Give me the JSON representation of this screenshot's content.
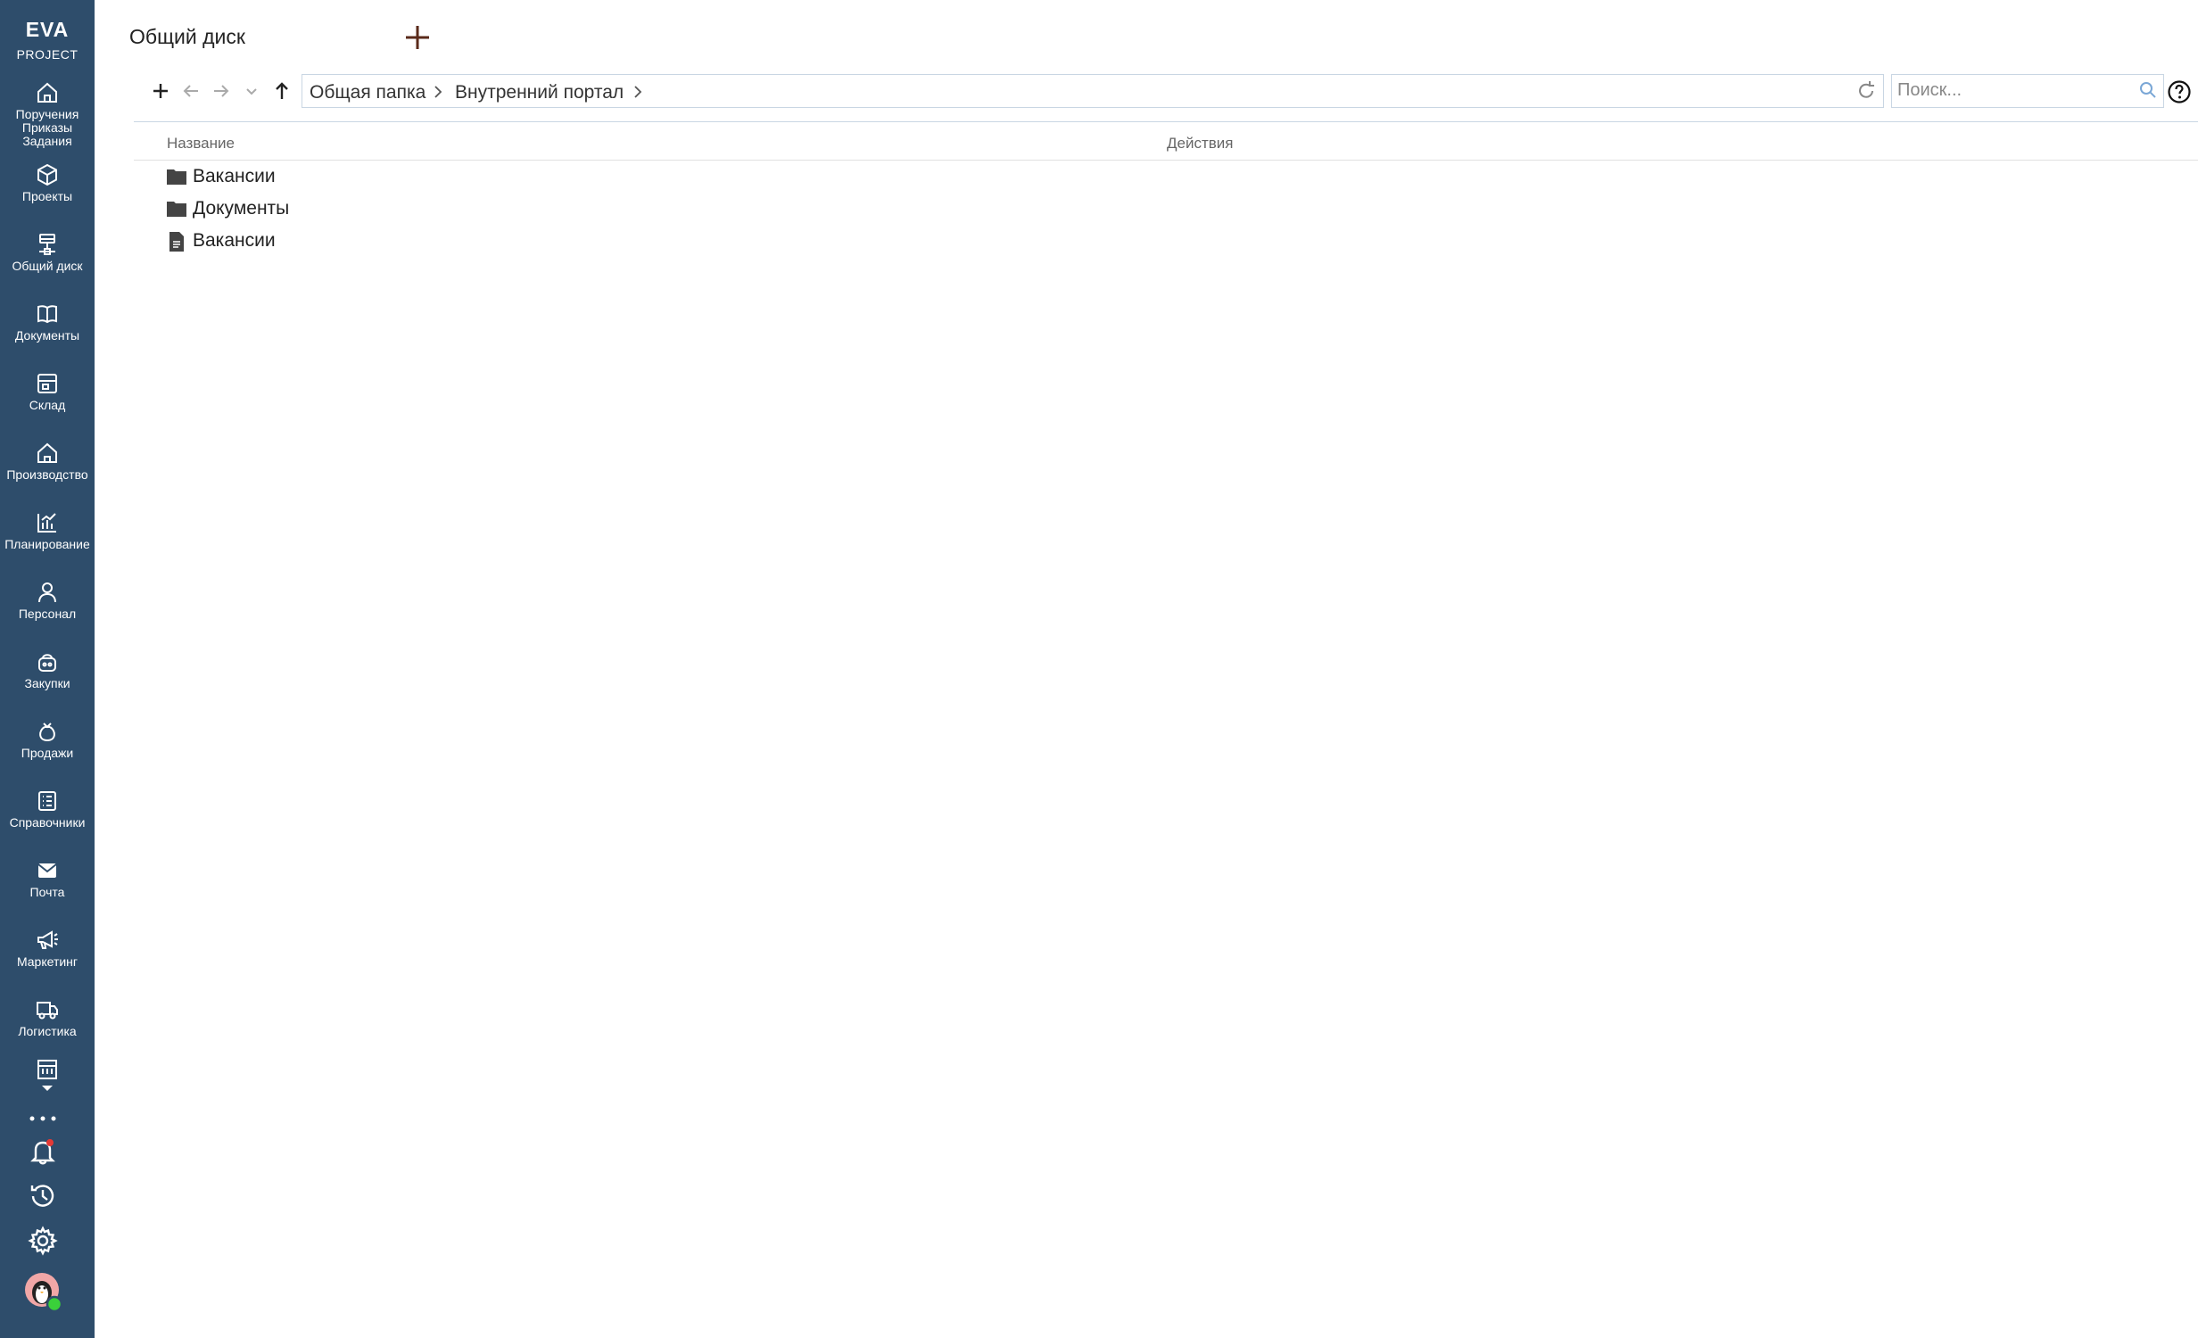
{
  "sidebar": {
    "logo_top": "EVA",
    "logo_bottom": "PROJECT",
    "items": [
      {
        "label": "Поручения\nПриказы\nЗадания",
        "icon": "home-icon"
      },
      {
        "label": "Проекты",
        "icon": "cube-icon"
      },
      {
        "label": "Общий диск",
        "icon": "network-drive-icon"
      },
      {
        "label": "Документы",
        "icon": "book-icon"
      },
      {
        "label": "Склад",
        "icon": "warehouse-icon"
      },
      {
        "label": "Производство",
        "icon": "factory-icon"
      },
      {
        "label": "Планирование",
        "icon": "chart-icon"
      },
      {
        "label": "Персонал",
        "icon": "person-icon"
      },
      {
        "label": "Закупки",
        "icon": "basket-icon"
      },
      {
        "label": "Продажи",
        "icon": "moneybag-icon"
      },
      {
        "label": "Справочники",
        "icon": "list-icon"
      },
      {
        "label": "Почта",
        "icon": "mail-icon"
      },
      {
        "label": "Маркетинг",
        "icon": "megaphone-icon"
      },
      {
        "label": "Логистика",
        "icon": "truck-icon"
      }
    ]
  },
  "header": {
    "title": "Общий диск"
  },
  "breadcrumb": {
    "items": [
      "Общая папка",
      "Внутренний портал"
    ]
  },
  "search": {
    "placeholder": "Поиск..."
  },
  "table": {
    "columns": [
      "Название",
      "Действия"
    ],
    "rows": [
      {
        "type": "folder",
        "name": "Вакансии"
      },
      {
        "type": "folder",
        "name": "Документы"
      },
      {
        "type": "file",
        "name": "Вакансии"
      }
    ]
  },
  "colors": {
    "sidebar_bg": "#2e4d6b",
    "accent": "#8b2a1a",
    "notification_dot": "#e53935",
    "online_status": "#3ad13a"
  }
}
